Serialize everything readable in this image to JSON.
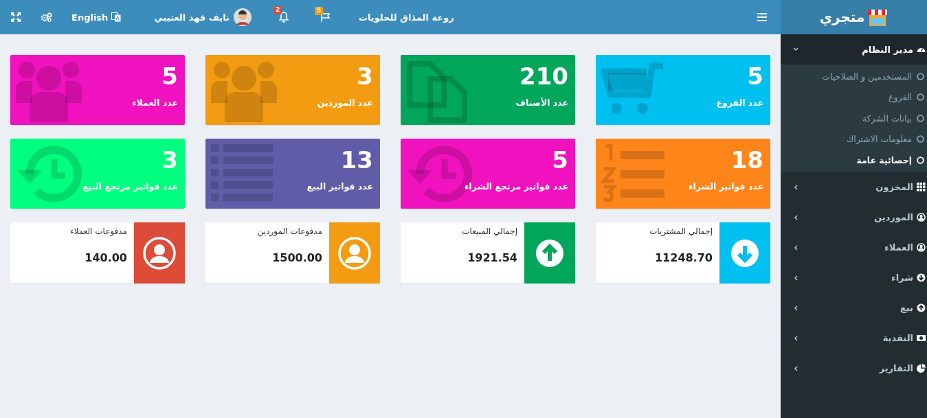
{
  "header": {
    "store_name": "روعة المذاق للحلويات",
    "flag_count": "5",
    "bell_count": "2",
    "user_name": "نايف فهد العتيبي",
    "language": "English"
  },
  "sidebar": {
    "brand": "متجري",
    "items": [
      {
        "label": "مدير النظام",
        "kind": "dashboard",
        "expanded": true,
        "children": [
          {
            "label": "المستخدمين و الصلاحيات",
            "selected": false
          },
          {
            "label": "الفروع",
            "selected": false
          },
          {
            "label": "بيانات الشركة",
            "selected": false
          },
          {
            "label": "معلومات الاشتراك",
            "selected": false
          },
          {
            "label": "إحصائية عامة",
            "selected": true
          }
        ]
      },
      {
        "label": "المخزون",
        "kind": "grid",
        "expanded": false
      },
      {
        "label": "الموردين",
        "kind": "person",
        "expanded": false
      },
      {
        "label": "العملاء",
        "kind": "person",
        "expanded": false
      },
      {
        "label": "شراء",
        "kind": "down",
        "expanded": false
      },
      {
        "label": "بيع",
        "kind": "up",
        "expanded": false
      },
      {
        "label": "النقدية",
        "kind": "money",
        "expanded": false
      },
      {
        "label": "التقارير",
        "kind": "pie",
        "expanded": false
      }
    ]
  },
  "stat_boxes": [
    {
      "value": "5",
      "label": "عدد الفروع",
      "color": "#00c0ef",
      "kind": "cart"
    },
    {
      "value": "210",
      "label": "عدد الأصناف",
      "color": "#00a65a",
      "kind": "files"
    },
    {
      "value": "3",
      "label": "عدد الموردين",
      "color": "#f39c12",
      "kind": "users"
    },
    {
      "value": "5",
      "label": "عدد العملاء",
      "color": "#f012be",
      "kind": "users"
    },
    {
      "value": "18",
      "label": "عدد فواتير الشراء",
      "color": "#ff851b",
      "kind": "numbered"
    },
    {
      "value": "5",
      "label": "عدد فواتير مرتجع الشراء",
      "color": "#f012be",
      "kind": "history"
    },
    {
      "value": "13",
      "label": "عدد فواتير البيع",
      "color": "#605ca8",
      "kind": "list"
    },
    {
      "value": "3",
      "label": "عدد فواتير مرتجع البيع",
      "color": "#00ff7f",
      "kind": "history"
    }
  ],
  "info_boxes": [
    {
      "label": "إجمالي المشتريات",
      "value": "11248.70",
      "color": "#00c0ef",
      "kind": "down"
    },
    {
      "label": "إجمالي المبيعات",
      "value": "1921.54",
      "color": "#00a65a",
      "kind": "up"
    },
    {
      "label": "مدفوعات الموردين",
      "value": "1500.00",
      "color": "#f39c12",
      "kind": "person"
    },
    {
      "label": "مدفوعات العملاء",
      "value": "140.00",
      "color": "#dd4b39",
      "kind": "person"
    }
  ]
}
